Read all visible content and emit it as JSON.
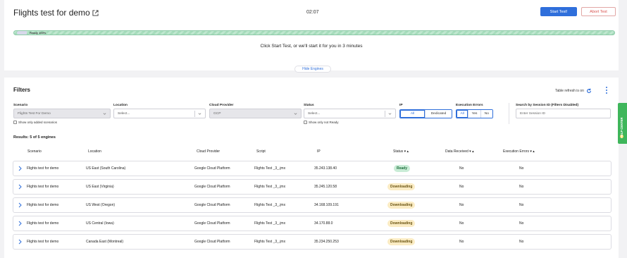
{
  "header": {
    "title": "Flights test for demo",
    "timer": "02:07",
    "start_label": "Start Test!",
    "abort_label": "Abort Test"
  },
  "progress": {
    "label": "Ready 100%",
    "value": 1.0,
    "color": "#a7dcbc"
  },
  "start_message": "Click Start Test, or we'll start it for you in 3 minutes",
  "hide_engines_label": "Hide Engines",
  "filters": {
    "title": "Filters",
    "refresh_label": "Table refresh is on",
    "scenario": {
      "label": "Scenario",
      "value": "Flights Test For Demo",
      "checkbox": "Show only added scenarios"
    },
    "location": {
      "label": "Location",
      "placeholder": "Select..."
    },
    "cloud_provider": {
      "label": "Cloud Provider",
      "value": "GCP"
    },
    "status": {
      "label": "Status",
      "placeholder": "Select...",
      "checkbox": "Show only not Ready"
    },
    "ip": {
      "label": "IP",
      "options": [
        "All",
        "Dedicated"
      ],
      "selected": "All"
    },
    "execution_errors": {
      "label": "Execution Errors",
      "options": [
        "All",
        "Yes",
        "No"
      ],
      "selected": "All"
    },
    "session": {
      "label": "Search by Session ID (Filters Disabled)",
      "placeholder": "Enter Session ID"
    }
  },
  "results_label": "Results: 5 of 5 engines",
  "table": {
    "columns": [
      "Scenario",
      "Location",
      "Cloud Provider",
      "Script",
      "IP",
      "Status ▾ ▴",
      "Data Received ▾ ▴",
      "Execution Errors ▾ ▴"
    ],
    "rows": [
      {
        "scenario": "Flights test for demo",
        "location": "US East (South Carolina)",
        "provider": "Google Cloud Platform",
        "script": "Flights Test _3_.jmx",
        "ip": "35.243.138.40",
        "status": "Ready",
        "data_received": "No",
        "errors": "No"
      },
      {
        "scenario": "Flights test for demo",
        "location": "US East (Virginia)",
        "provider": "Google Cloud Platform",
        "script": "Flights Test _3_.jmx",
        "ip": "35.245.120.58",
        "status": "Downloading",
        "data_received": "No",
        "errors": "No"
      },
      {
        "scenario": "Flights test for demo",
        "location": "US West (Oregon)",
        "provider": "Google Cloud Platform",
        "script": "Flights Test _3_.jmx",
        "ip": "34.168.109.191",
        "status": "Downloading",
        "data_received": "No",
        "errors": "No"
      },
      {
        "scenario": "Flights test for demo",
        "location": "US Central (Iowa)",
        "provider": "Google Cloud Platform",
        "script": "Flights Test _3_.jmx",
        "ip": "34.170.88.0",
        "status": "Downloading",
        "data_received": "No",
        "errors": "No"
      },
      {
        "scenario": "Flights test for demo",
        "location": "Canada East (Montreal)",
        "provider": "Google Cloud Platform",
        "script": "Flights Test _3_.jmx",
        "ip": "35.234.250.253",
        "status": "Downloading",
        "data_received": "No",
        "errors": "No"
      }
    ]
  },
  "help_center_label": "HELP CENTER",
  "colors": {
    "accent": "#2f6fdb",
    "abort": "#d9534f",
    "ready": "#c9ecd6",
    "downloading": "#fbecc4",
    "help": "#3fb65b"
  }
}
